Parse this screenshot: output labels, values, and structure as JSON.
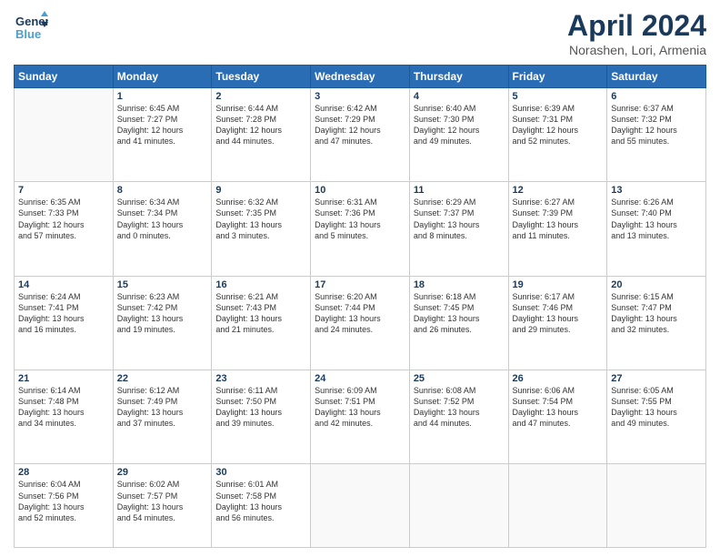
{
  "header": {
    "logo_line1": "General",
    "logo_line2": "Blue",
    "month": "April 2024",
    "location": "Norashen, Lori, Armenia"
  },
  "weekdays": [
    "Sunday",
    "Monday",
    "Tuesday",
    "Wednesday",
    "Thursday",
    "Friday",
    "Saturday"
  ],
  "weeks": [
    [
      {
        "day": "",
        "info": ""
      },
      {
        "day": "1",
        "info": "Sunrise: 6:45 AM\nSunset: 7:27 PM\nDaylight: 12 hours\nand 41 minutes."
      },
      {
        "day": "2",
        "info": "Sunrise: 6:44 AM\nSunset: 7:28 PM\nDaylight: 12 hours\nand 44 minutes."
      },
      {
        "day": "3",
        "info": "Sunrise: 6:42 AM\nSunset: 7:29 PM\nDaylight: 12 hours\nand 47 minutes."
      },
      {
        "day": "4",
        "info": "Sunrise: 6:40 AM\nSunset: 7:30 PM\nDaylight: 12 hours\nand 49 minutes."
      },
      {
        "day": "5",
        "info": "Sunrise: 6:39 AM\nSunset: 7:31 PM\nDaylight: 12 hours\nand 52 minutes."
      },
      {
        "day": "6",
        "info": "Sunrise: 6:37 AM\nSunset: 7:32 PM\nDaylight: 12 hours\nand 55 minutes."
      }
    ],
    [
      {
        "day": "7",
        "info": "Sunrise: 6:35 AM\nSunset: 7:33 PM\nDaylight: 12 hours\nand 57 minutes."
      },
      {
        "day": "8",
        "info": "Sunrise: 6:34 AM\nSunset: 7:34 PM\nDaylight: 13 hours\nand 0 minutes."
      },
      {
        "day": "9",
        "info": "Sunrise: 6:32 AM\nSunset: 7:35 PM\nDaylight: 13 hours\nand 3 minutes."
      },
      {
        "day": "10",
        "info": "Sunrise: 6:31 AM\nSunset: 7:36 PM\nDaylight: 13 hours\nand 5 minutes."
      },
      {
        "day": "11",
        "info": "Sunrise: 6:29 AM\nSunset: 7:37 PM\nDaylight: 13 hours\nand 8 minutes."
      },
      {
        "day": "12",
        "info": "Sunrise: 6:27 AM\nSunset: 7:39 PM\nDaylight: 13 hours\nand 11 minutes."
      },
      {
        "day": "13",
        "info": "Sunrise: 6:26 AM\nSunset: 7:40 PM\nDaylight: 13 hours\nand 13 minutes."
      }
    ],
    [
      {
        "day": "14",
        "info": "Sunrise: 6:24 AM\nSunset: 7:41 PM\nDaylight: 13 hours\nand 16 minutes."
      },
      {
        "day": "15",
        "info": "Sunrise: 6:23 AM\nSunset: 7:42 PM\nDaylight: 13 hours\nand 19 minutes."
      },
      {
        "day": "16",
        "info": "Sunrise: 6:21 AM\nSunset: 7:43 PM\nDaylight: 13 hours\nand 21 minutes."
      },
      {
        "day": "17",
        "info": "Sunrise: 6:20 AM\nSunset: 7:44 PM\nDaylight: 13 hours\nand 24 minutes."
      },
      {
        "day": "18",
        "info": "Sunrise: 6:18 AM\nSunset: 7:45 PM\nDaylight: 13 hours\nand 26 minutes."
      },
      {
        "day": "19",
        "info": "Sunrise: 6:17 AM\nSunset: 7:46 PM\nDaylight: 13 hours\nand 29 minutes."
      },
      {
        "day": "20",
        "info": "Sunrise: 6:15 AM\nSunset: 7:47 PM\nDaylight: 13 hours\nand 32 minutes."
      }
    ],
    [
      {
        "day": "21",
        "info": "Sunrise: 6:14 AM\nSunset: 7:48 PM\nDaylight: 13 hours\nand 34 minutes."
      },
      {
        "day": "22",
        "info": "Sunrise: 6:12 AM\nSunset: 7:49 PM\nDaylight: 13 hours\nand 37 minutes."
      },
      {
        "day": "23",
        "info": "Sunrise: 6:11 AM\nSunset: 7:50 PM\nDaylight: 13 hours\nand 39 minutes."
      },
      {
        "day": "24",
        "info": "Sunrise: 6:09 AM\nSunset: 7:51 PM\nDaylight: 13 hours\nand 42 minutes."
      },
      {
        "day": "25",
        "info": "Sunrise: 6:08 AM\nSunset: 7:52 PM\nDaylight: 13 hours\nand 44 minutes."
      },
      {
        "day": "26",
        "info": "Sunrise: 6:06 AM\nSunset: 7:54 PM\nDaylight: 13 hours\nand 47 minutes."
      },
      {
        "day": "27",
        "info": "Sunrise: 6:05 AM\nSunset: 7:55 PM\nDaylight: 13 hours\nand 49 minutes."
      }
    ],
    [
      {
        "day": "28",
        "info": "Sunrise: 6:04 AM\nSunset: 7:56 PM\nDaylight: 13 hours\nand 52 minutes."
      },
      {
        "day": "29",
        "info": "Sunrise: 6:02 AM\nSunset: 7:57 PM\nDaylight: 13 hours\nand 54 minutes."
      },
      {
        "day": "30",
        "info": "Sunrise: 6:01 AM\nSunset: 7:58 PM\nDaylight: 13 hours\nand 56 minutes."
      },
      {
        "day": "",
        "info": ""
      },
      {
        "day": "",
        "info": ""
      },
      {
        "day": "",
        "info": ""
      },
      {
        "day": "",
        "info": ""
      }
    ]
  ]
}
